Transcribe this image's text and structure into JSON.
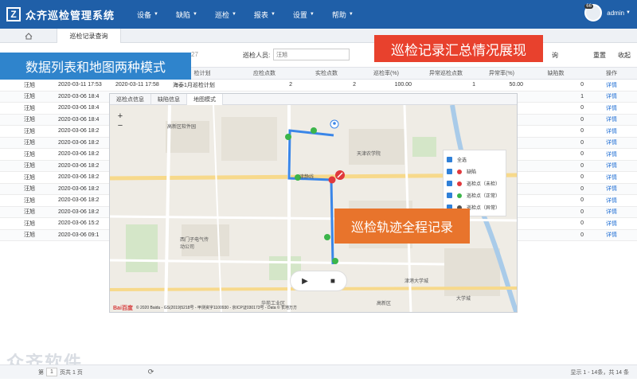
{
  "app": {
    "logo_letter": "Z",
    "title": "众齐巡检管理系统",
    "nav": [
      {
        "label": "设备"
      },
      {
        "label": "缺陷"
      },
      {
        "label": "巡检"
      },
      {
        "label": "报表"
      },
      {
        "label": "设置"
      },
      {
        "label": "帮助"
      }
    ],
    "notification_count": "66",
    "user": "admin"
  },
  "tabs": {
    "home_icon": "home-icon",
    "current": "巡检记录查询"
  },
  "filters": {
    "date_fragment": "27",
    "inspector_label": "巡检人员:",
    "inspector_value": "汪旭",
    "query_fragment": "询",
    "reset": "重置",
    "collapse": "收起"
  },
  "table": {
    "headers": [
      "",
      "",
      "",
      "检计划",
      "应检点数",
      "实检点数",
      "巡检率(%)",
      "异常巡检点数",
      "异常率(%)",
      "缺陷数",
      "操作"
    ],
    "rows": [
      [
        "汪旭",
        "2020-03-11 17:53",
        "2020-03-11 17:58",
        "海泰1月巡检计划",
        "2",
        "2",
        "100.00",
        "1",
        "50.00",
        "0",
        "详情"
      ],
      [
        "汪旭",
        "2020-03-06 18:4",
        "",
        "",
        "",
        "",
        "",
        "",
        "",
        "1",
        "详情"
      ],
      [
        "汪旭",
        "2020-03-06 18:4",
        "",
        "",
        "",
        "",
        "",
        "",
        "",
        "0",
        "详情"
      ],
      [
        "汪旭",
        "2020-03-06 18:4",
        "",
        "",
        "",
        "",
        "",
        "",
        "",
        "0",
        "详情"
      ],
      [
        "汪旭",
        "2020-03-06 18:2",
        "",
        "",
        "",
        "",
        "",
        "",
        "",
        "0",
        "详情"
      ],
      [
        "汪旭",
        "2020-03-06 18:2",
        "",
        "",
        "",
        "",
        "",
        "",
        "",
        "0",
        "详情"
      ],
      [
        "汪旭",
        "2020-03-06 18:2",
        "",
        "",
        "",
        "",
        "",
        "",
        "",
        "0",
        "详情"
      ],
      [
        "汪旭",
        "2020-03-06 18:2",
        "",
        "",
        "",
        "",
        "",
        "",
        "",
        "0",
        "详情"
      ],
      [
        "汪旭",
        "2020-03-06 18:2",
        "",
        "",
        "",
        "",
        "",
        "",
        "",
        "0",
        "详情"
      ],
      [
        "汪旭",
        "2020-03-06 18:2",
        "",
        "",
        "",
        "",
        "",
        "",
        "",
        "0",
        "详情"
      ],
      [
        "汪旭",
        "2020-03-06 18:2",
        "",
        "",
        "",
        "",
        "",
        "",
        "",
        "0",
        "详情"
      ],
      [
        "汪旭",
        "2020-03-06 18:2",
        "",
        "",
        "",
        "",
        "",
        "",
        "",
        "0",
        "详情"
      ],
      [
        "汪旭",
        "2020-03-06 15:2",
        "",
        "",
        "",
        "",
        "",
        "",
        "",
        "0",
        "详情"
      ],
      [
        "汪旭",
        "2020-03-06 09:1",
        "",
        "",
        "",
        "",
        "",
        "",
        "",
        "0",
        "详情"
      ]
    ]
  },
  "map": {
    "tabs": [
      "巡检点信息",
      "缺陷信息",
      "地图模式"
    ],
    "zoom_in": "+",
    "zoom_out": "−",
    "labels": {
      "a": "高新区软件园",
      "b": "天津农学院",
      "c": "津静线",
      "d": "西门子电气传动公司",
      "e": "津港大学城",
      "f": "华苑工业区",
      "g": "高新区",
      "h": "大学城"
    },
    "legend": [
      {
        "label": "全选",
        "color": ""
      },
      {
        "label": "缺陷",
        "color": "#e0393d",
        "icon": "defect-icon"
      },
      {
        "label": "巡检点（未检）",
        "color": "#e0393d"
      },
      {
        "label": "巡检点（正常）",
        "color": "#3bb54a"
      },
      {
        "label": "巡检点（异常）",
        "color": "#555555"
      }
    ],
    "copyright": "© 2020 Baidu - GS(2019)5218号 - 甲测资字1100930 - 京ICP证030173号 - Data © 长地万方",
    "baidu": "Bai百度",
    "track_color": "#3a86e8",
    "green": "#3bb54a",
    "red": "#e0393d"
  },
  "callouts": {
    "left": "数据列表和地图两种模式",
    "right": "巡检记录汇总情况展现",
    "map": "巡检轨迹全程记录"
  },
  "watermark": "众齐软件",
  "pager": {
    "prefix": "第",
    "page": "1",
    "suffix": "页共 1 页",
    "summary": "显示 1 - 14条，共 14 条"
  }
}
